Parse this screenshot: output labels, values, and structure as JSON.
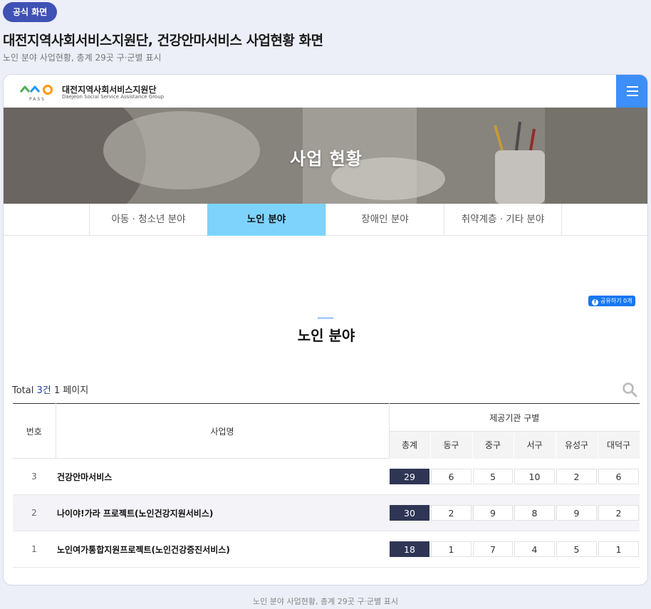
{
  "badge": "공식 화면",
  "page": {
    "title": "대전지역사회서비스지원단, 건강안마서비스 사업현황 화면",
    "subtitle": "노인 분야 사업현황, 총계 29곳 구·군별 표시",
    "caption": "노인 분야 사업현황, 총계 29곳 구·군별 표시"
  },
  "header": {
    "logo_ko": "대전지역사회서비스지원단",
    "logo_en": "Daejeon Social Service Assistance Group",
    "logo_mark_text": "PASS",
    "menu_icon": "hamburger-icon"
  },
  "hero": {
    "title": "사업 현황"
  },
  "tabs": [
    {
      "label": "아동 · 청소년 분야",
      "active": false
    },
    {
      "label": "노인 분야",
      "active": true
    },
    {
      "label": "장애인 분야",
      "active": false
    },
    {
      "label": "취약계층 · 기타 분야",
      "active": false
    }
  ],
  "share": {
    "label": "공유하기 0개",
    "icon": "facebook-icon"
  },
  "section": {
    "title": "노인 분야"
  },
  "summary": {
    "prefix": "Total ",
    "count": "3건",
    "pages": " 1 페이지"
  },
  "colors": {
    "accent": "#3d8ef7",
    "active_tab": "#7dd3fb",
    "total_cell": "#2f3655",
    "badge": "#3f51b5"
  },
  "table": {
    "headers": {
      "no": "번호",
      "name": "사업명",
      "provider_group": "제공기관 구별",
      "districts": [
        "총계",
        "동구",
        "중구",
        "서구",
        "유성구",
        "대덕구"
      ]
    },
    "rows": [
      {
        "no": "3",
        "name": "건강안마서비스",
        "values": [
          "29",
          "6",
          "5",
          "10",
          "2",
          "6"
        ]
      },
      {
        "no": "2",
        "name": "나이야!가라 프로젝트(노인건강지원서비스)",
        "values": [
          "30",
          "2",
          "9",
          "8",
          "9",
          "2"
        ]
      },
      {
        "no": "1",
        "name": "노인여가통합지원프로젝트(노인건강증진서비스)",
        "values": [
          "18",
          "1",
          "7",
          "4",
          "5",
          "1"
        ]
      }
    ]
  }
}
